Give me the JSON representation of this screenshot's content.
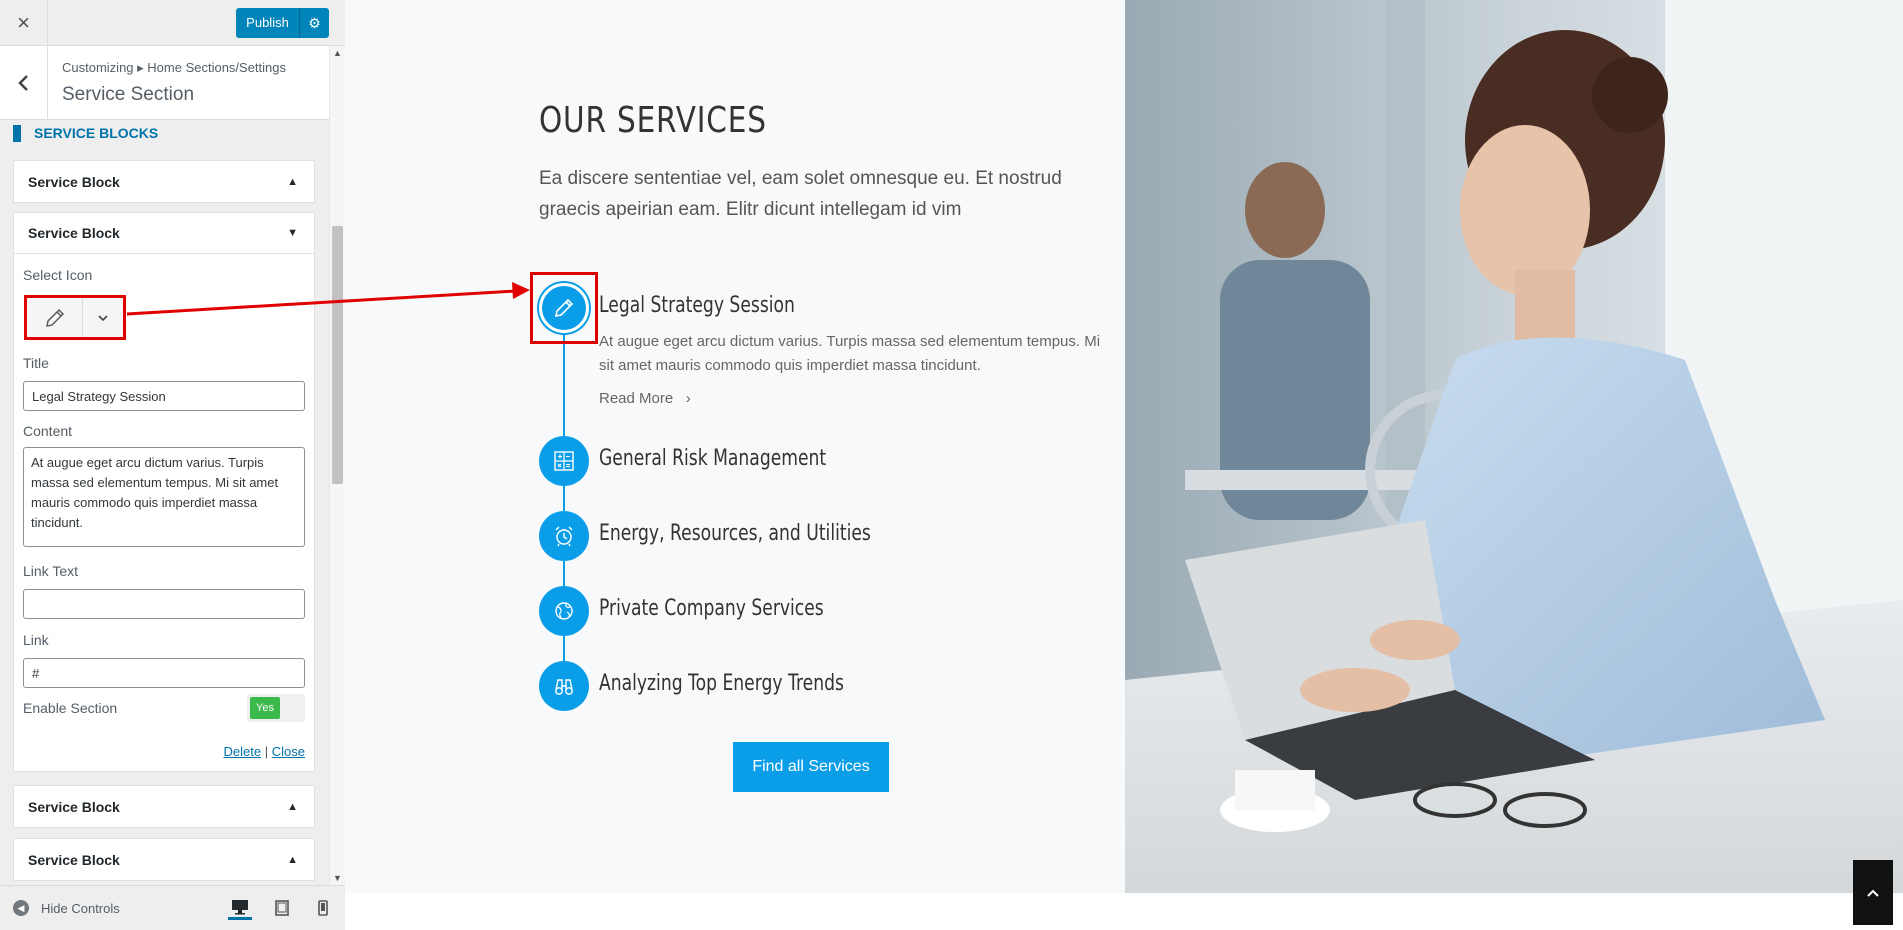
{
  "topbar": {
    "close_label": "×",
    "publish_label": "Publish"
  },
  "section_head": {
    "breadcrumb": "Customizing ▸ Home Sections/Settings",
    "title": "Service Section"
  },
  "service_blocks": {
    "heading": "SERVICE BLOCKS",
    "collapsed_label": "Service Block",
    "open_block": {
      "label": "Service Block",
      "select_icon_label": "Select Icon",
      "title_label": "Title",
      "title_value": "Legal Strategy Session",
      "content_label": "Content",
      "content_value": "At augue eget arcu dictum varius. Turpis massa sed elementum tempus. Mi sit amet mauris commodo quis imperdiet massa tincidunt.",
      "link_text_label": "Link Text",
      "link_text_value": "",
      "link_label": "Link",
      "link_value": "#",
      "enable_label": "Enable Section",
      "enable_value": "Yes",
      "delete_label": "Delete",
      "separator": "|",
      "close_label": "Close"
    }
  },
  "footer": {
    "hide_controls_label": "Hide Controls"
  },
  "preview": {
    "title": "OUR SERVICES",
    "description": "Ea discere sententiae vel, eam solet omnesque eu. Et nostrud graecis apeirian eam. Elitr dicunt intellegam id vim",
    "services": [
      {
        "name": "Legal Strategy Session",
        "icon": "pencil-icon",
        "desc": "At augue eget arcu dictum varius. Turpis massa sed elementum tempus. Mi sit amet mauris commodo quis imperdiet massa tincidunt.",
        "read_more": "Read More"
      },
      {
        "name": "General Risk Management",
        "icon": "calculator-icon"
      },
      {
        "name": "Energy, Resources, and Utilities",
        "icon": "alarm-clock-icon"
      },
      {
        "name": "Private Company Services",
        "icon": "globe-icon"
      },
      {
        "name": "Analyzing Top Energy Trends",
        "icon": "binoculars-icon"
      }
    ],
    "cta_label": "Find all Services"
  },
  "colors": {
    "accent": "#0b9ee8",
    "publish": "#0085ba",
    "highlight": "#e00000",
    "toggle_on": "#3bb94a"
  }
}
